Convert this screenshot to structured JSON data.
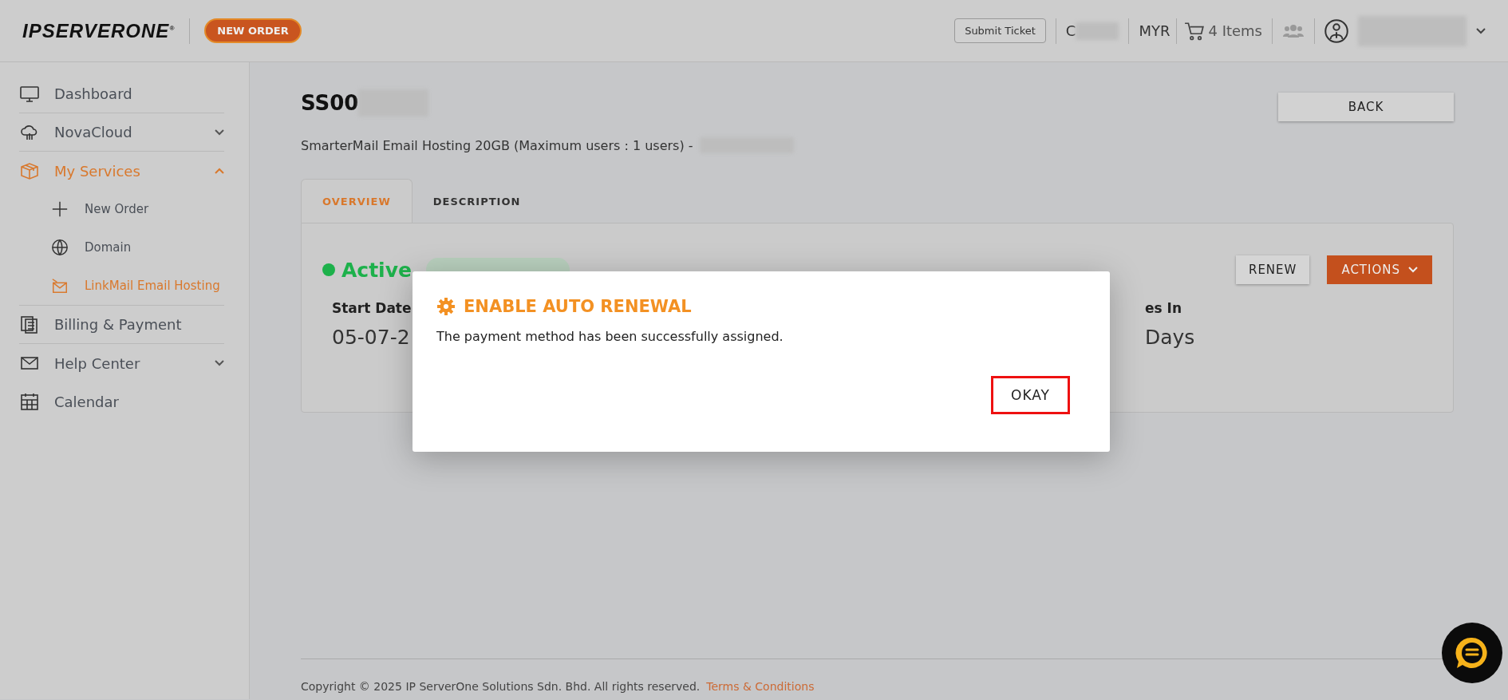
{
  "header": {
    "logo": "IPSERVERONE$^{®}$",
    "new_order": "NEW ORDER",
    "submit_ticket": "Submit Ticket",
    "account_initial": "C",
    "currency": "MYR",
    "cart": "4 Items"
  },
  "sidebar": {
    "items": [
      {
        "label": "Dashboard",
        "kind": "link",
        "selected": false
      },
      {
        "label": "NovaCloud",
        "kind": "group",
        "selected": false,
        "expanded": false
      },
      {
        "label": "My Services",
        "kind": "group",
        "selected": true,
        "expanded": true,
        "children": [
          {
            "label": "New Order",
            "selected": false
          },
          {
            "label": "Domain",
            "selected": false
          },
          {
            "label": "LinkMail Email Hosting",
            "selected": true
          }
        ]
      },
      {
        "label": "Billing & Payment",
        "kind": "link",
        "selected": false
      },
      {
        "label": "Help Center",
        "kind": "group",
        "selected": false,
        "expanded": false
      },
      {
        "label": "Calendar",
        "kind": "link",
        "selected": false
      }
    ]
  },
  "main": {
    "title": "SS00",
    "subtitle": "SmarterMail Email Hosting 20GB (Maximum users : 1 users) -",
    "back": "BACK",
    "tabs": [
      {
        "label": "OVERVIEW",
        "selected": true
      },
      {
        "label": "DESCRIPTION",
        "selected": false
      }
    ],
    "status": "Active",
    "renew": "RENEW",
    "actions": "ACTIONS",
    "fields": [
      {
        "label": "Start Date",
        "value": "05-07-2"
      },
      {
        "label": "es In",
        "value": "Days"
      }
    ]
  },
  "dialog": {
    "title": "ENABLE AUTO RENEWAL",
    "message": "The payment method has been successfully assigned.",
    "button": "OKAY"
  },
  "footer": {
    "copyright": "Copyright © 2025 IP ServerOne Solutions Sdn. Bhd. All rights reserved.",
    "link": "Terms & Conditions"
  }
}
